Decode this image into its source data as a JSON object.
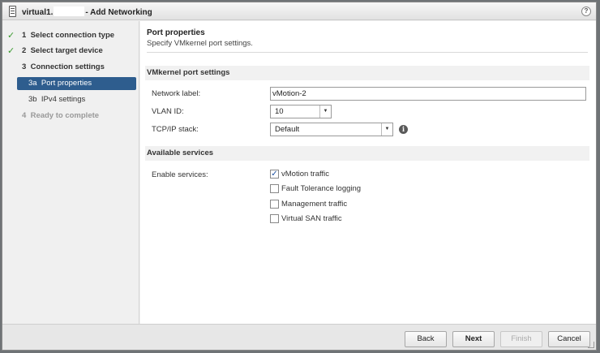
{
  "window": {
    "title_prefix": "virtual1.",
    "title_suffix": "- Add Networking",
    "help_glyph": "?"
  },
  "steps": [
    {
      "num": "1",
      "label": "Select connection type",
      "state": "completed"
    },
    {
      "num": "2",
      "label": "Select target device",
      "state": "completed"
    },
    {
      "num": "3",
      "label": "Connection settings",
      "state": "current-group"
    },
    {
      "num": "3a",
      "label": "Port properties",
      "state": "active"
    },
    {
      "num": "3b",
      "label": "IPv4 settings",
      "state": "pending"
    },
    {
      "num": "4",
      "label": "Ready to complete",
      "state": "disabled"
    }
  ],
  "page": {
    "title": "Port properties",
    "subtitle": "Specify VMkernel port settings."
  },
  "vmk_section": {
    "heading": "VMkernel port settings",
    "network_label_label": "Network label:",
    "network_label_value": "vMotion-2",
    "vlan_label": "VLAN ID:",
    "vlan_value": "10",
    "tcpip_label": "TCP/IP stack:",
    "tcpip_value": "Default",
    "info_glyph": "i"
  },
  "services_section": {
    "heading": "Available services",
    "enable_label": "Enable services:",
    "services": [
      {
        "label": "vMotion traffic",
        "checked": true
      },
      {
        "label": "Fault Tolerance logging",
        "checked": false
      },
      {
        "label": "Management traffic",
        "checked": false
      },
      {
        "label": "Virtual SAN traffic",
        "checked": false
      }
    ]
  },
  "footer": {
    "back": "Back",
    "next": "Next",
    "finish": "Finish",
    "cancel": "Cancel"
  },
  "colors": {
    "active_step_bg": "#2e5d8e",
    "check_green": "#3a9a2e"
  }
}
